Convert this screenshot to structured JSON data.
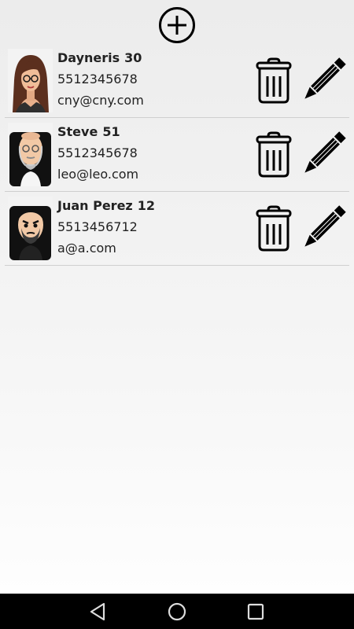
{
  "toolbar": {
    "add_icon": "plus-circle-icon"
  },
  "contacts": [
    {
      "name": "Dayneris",
      "age": "30",
      "phone": "5512345678",
      "email": "cny@cny.com"
    },
    {
      "name": "Steve",
      "age": "51",
      "phone": "5512345678",
      "email": "leo@leo.com"
    },
    {
      "name": "Juan Perez",
      "age": "12",
      "phone": "5513456712",
      "email": "a@a.com"
    }
  ],
  "row_actions": {
    "delete_icon": "trash-icon",
    "edit_icon": "pencil-icon"
  },
  "navigation": {
    "back_icon": "triangle-back-icon",
    "home_icon": "circle-home-icon",
    "recents_icon": "square-recents-icon"
  },
  "colors": {
    "icon": "#000000",
    "divider": "#cfcfcf",
    "nav_bar": "#000000"
  }
}
